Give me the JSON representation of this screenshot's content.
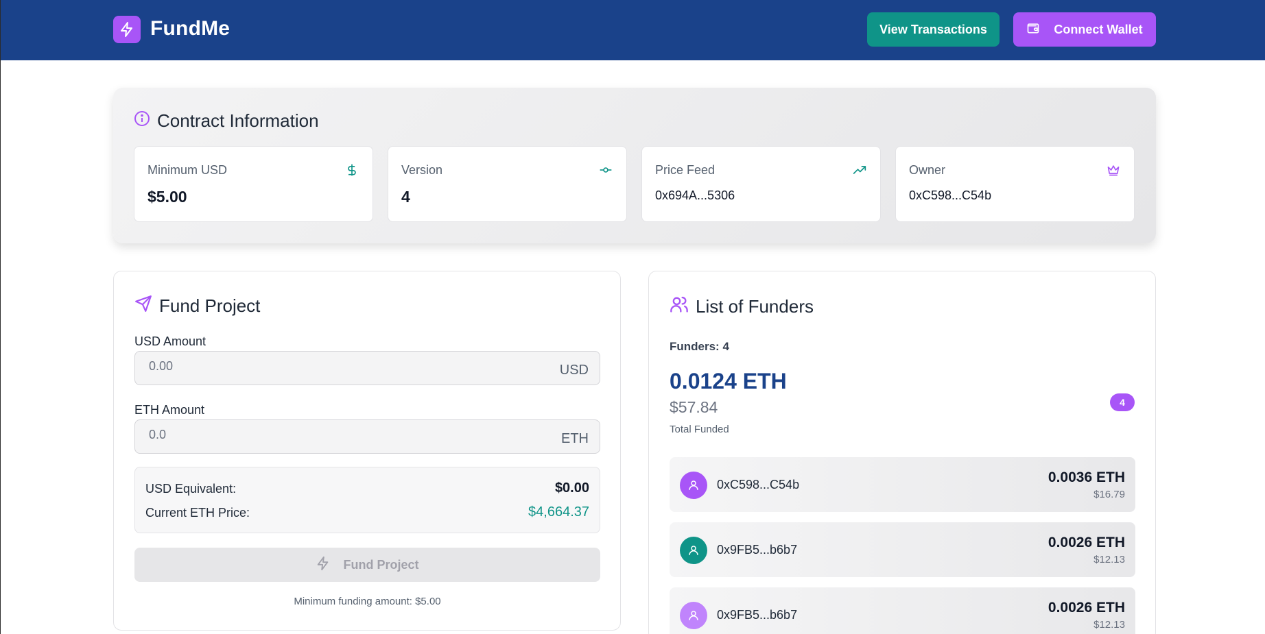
{
  "header": {
    "app_name": "FundMe",
    "view_transactions": "View Transactions",
    "connect_wallet": "Connect Wallet"
  },
  "contract": {
    "title": "Contract Information",
    "cards": [
      {
        "label": "Minimum USD",
        "value": "$5.00",
        "icon": "dollar-icon"
      },
      {
        "label": "Version",
        "value": "4",
        "icon": "git-commit-icon"
      },
      {
        "label": "Price Feed",
        "value": "0x694A...5306",
        "icon": "trending-up-icon"
      },
      {
        "label": "Owner",
        "value": "0xC598...C54b",
        "icon": "crown-icon"
      }
    ]
  },
  "fund": {
    "title": "Fund Project",
    "usd_label": "USD Amount",
    "usd_placeholder": "0.00",
    "usd_unit": "USD",
    "eth_label": "ETH Amount",
    "eth_placeholder": "0.0",
    "eth_unit": "ETH",
    "usd_equivalent_label": "USD Equivalent:",
    "usd_equivalent_value": "$0.00",
    "eth_price_label": "Current ETH Price:",
    "eth_price_value": "$4,664.37",
    "button": "Fund Project",
    "min_note": "Minimum funding amount: $5.00"
  },
  "funders": {
    "title": "List of Funders",
    "count_text": "Funders: 4",
    "total_eth": "0.0124 ETH",
    "total_usd": "$57.84",
    "total_label": "Total Funded",
    "badge": "4",
    "rows": [
      {
        "address": "0xC598...C54b",
        "eth": "0.0036 ETH",
        "usd": "$16.79",
        "color": "#a855f7"
      },
      {
        "address": "0x9FB5...b6b7",
        "eth": "0.0026 ETH",
        "usd": "$12.13",
        "color": "#0f9488"
      },
      {
        "address": "0x9FB5...b6b7",
        "eth": "0.0026 ETH",
        "usd": "$12.13",
        "color": "#c084fc"
      }
    ]
  },
  "colors": {
    "header_bg": "#1a428a",
    "accent_purple": "#a855f7",
    "accent_teal": "#0f9488"
  }
}
